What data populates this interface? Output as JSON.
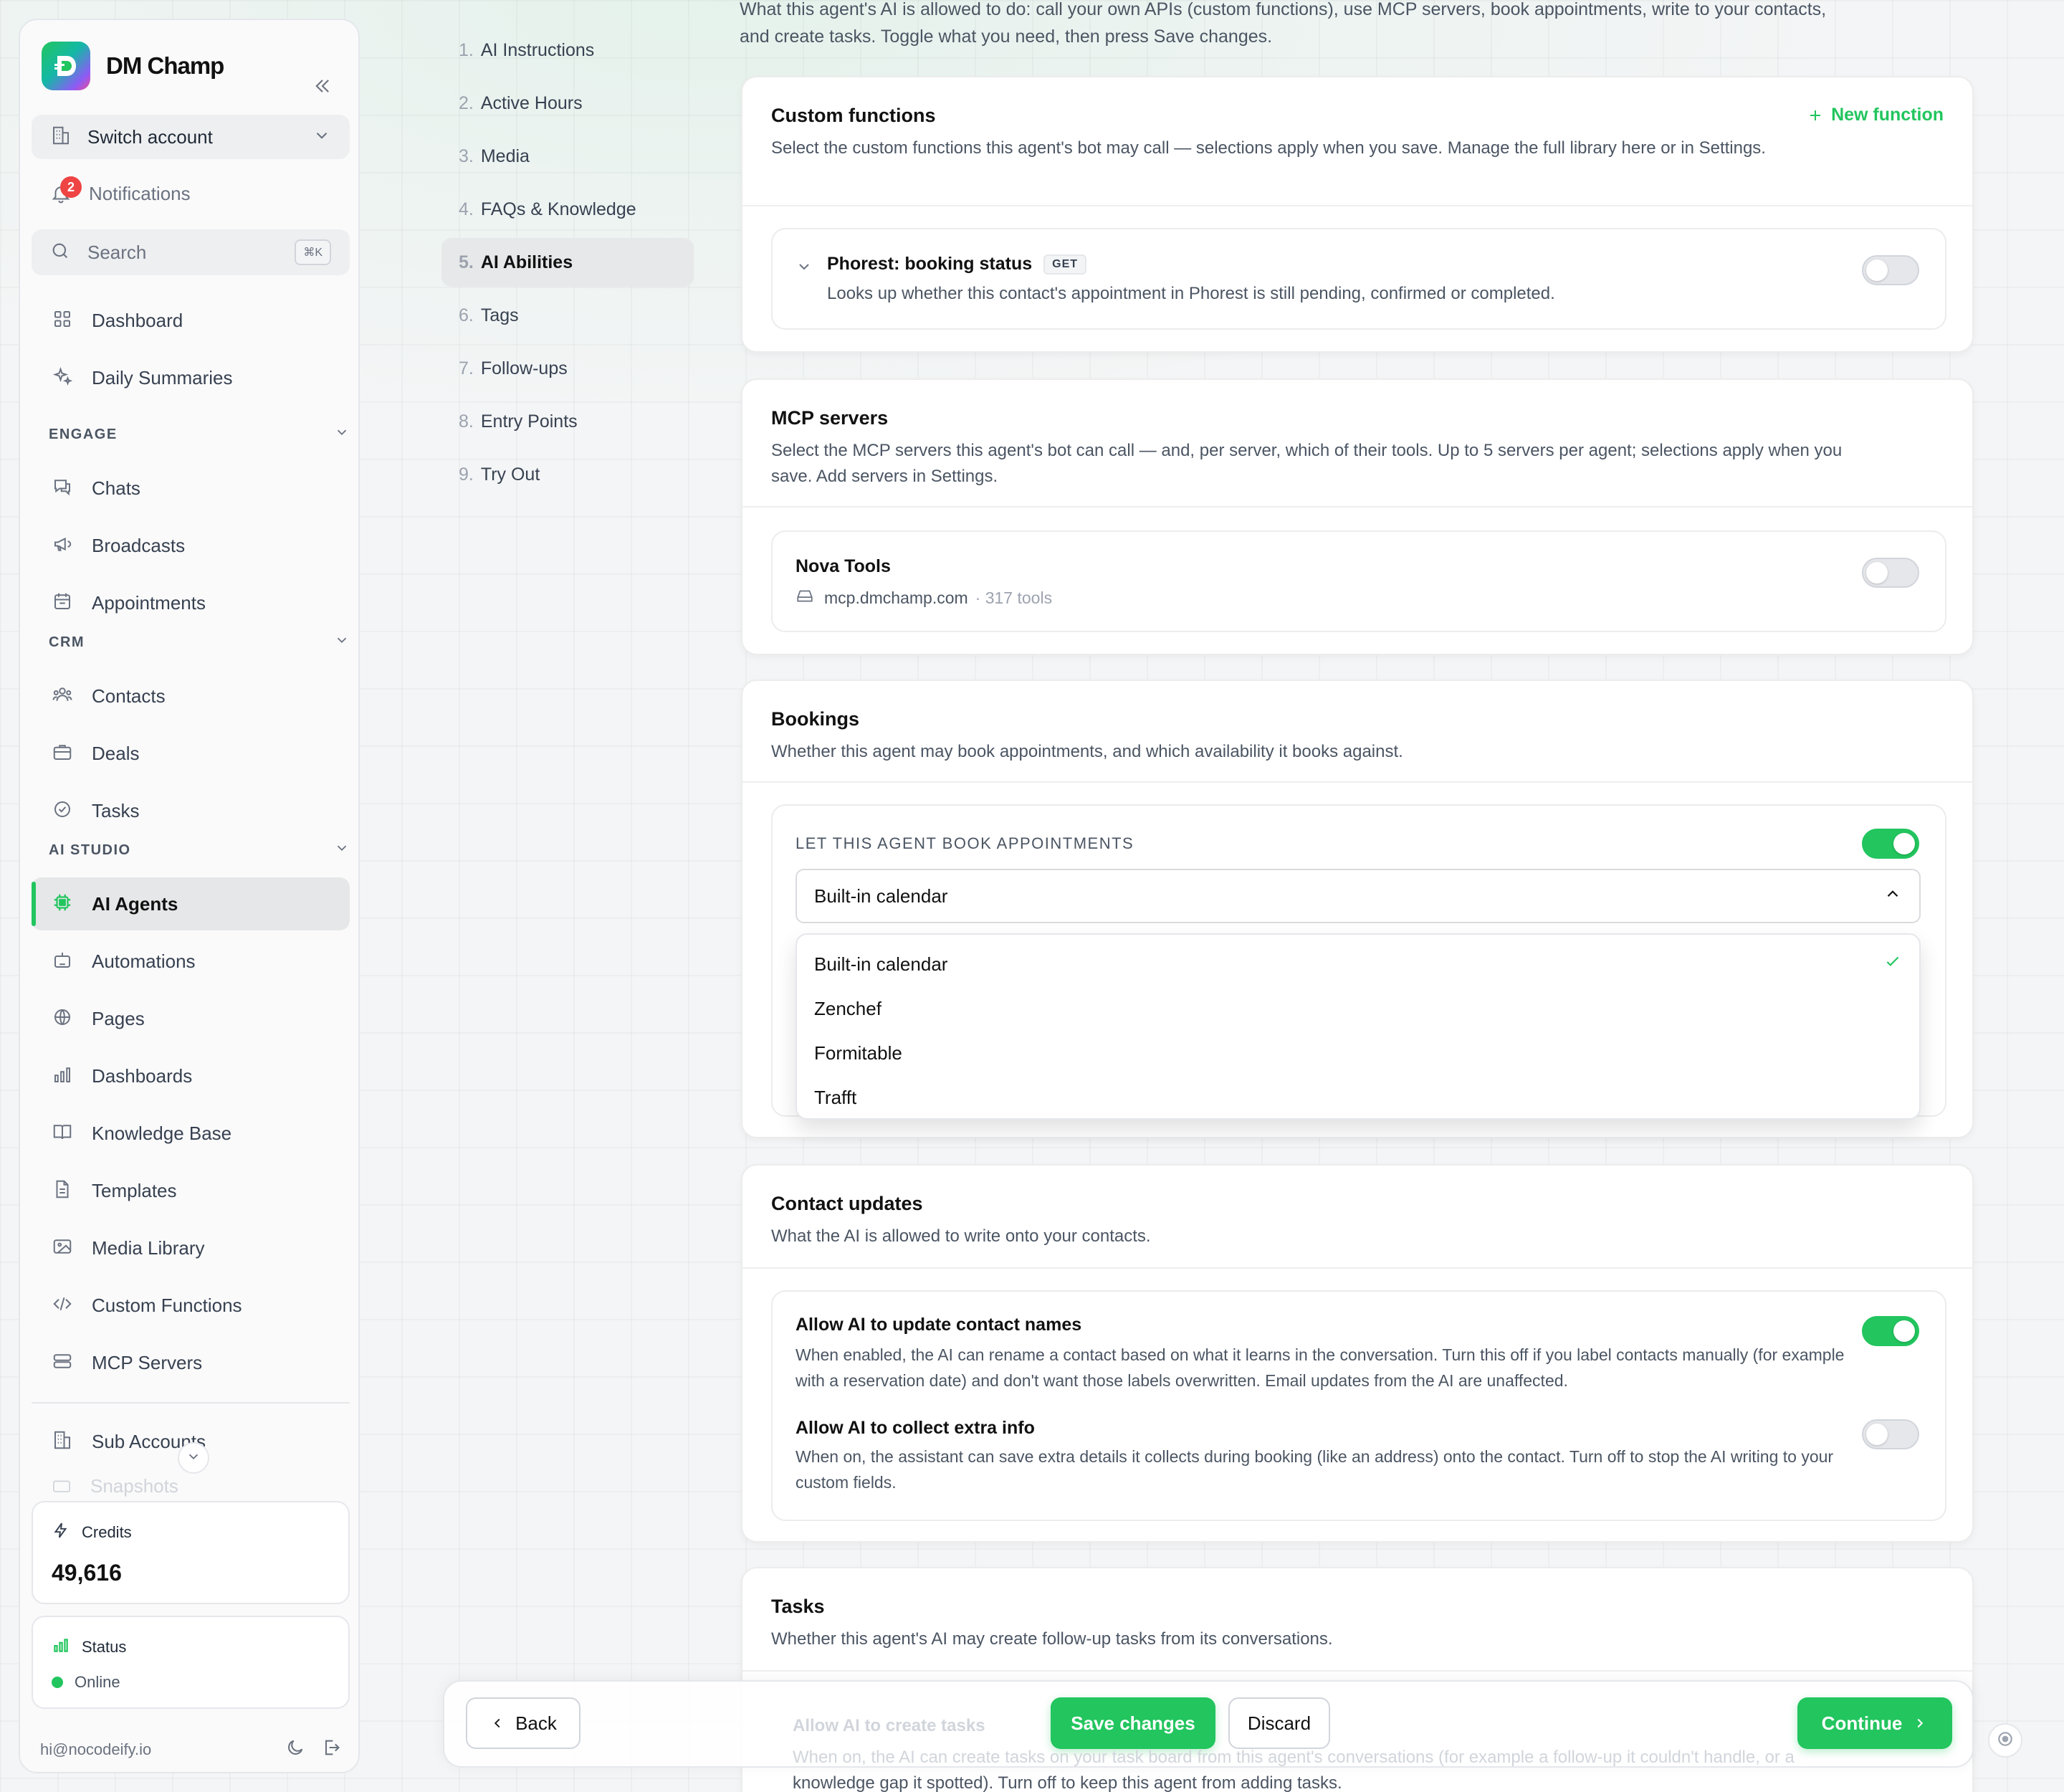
{
  "brand": {
    "name": "DM Champ"
  },
  "sidebar": {
    "switch_account": "Switch account",
    "notifications": {
      "label": "Notifications",
      "count": "2"
    },
    "search": {
      "label": "Search",
      "shortcut": "⌘K"
    },
    "top_items": [
      {
        "label": "Dashboard",
        "icon": "grid-icon"
      },
      {
        "label": "Daily Summaries",
        "icon": "sparkles-icon"
      }
    ],
    "sections": [
      {
        "title": "ENGAGE",
        "items": [
          {
            "label": "Chats",
            "icon": "chat-icon"
          },
          {
            "label": "Broadcasts",
            "icon": "megaphone-icon"
          },
          {
            "label": "Appointments",
            "icon": "calendar-icon"
          }
        ]
      },
      {
        "title": "CRM",
        "items": [
          {
            "label": "Contacts",
            "icon": "users-icon"
          },
          {
            "label": "Deals",
            "icon": "briefcase-icon"
          },
          {
            "label": "Tasks",
            "icon": "check-circle-icon"
          }
        ]
      },
      {
        "title": "AI STUDIO",
        "items": [
          {
            "label": "AI Agents",
            "icon": "chip-icon",
            "active": true
          },
          {
            "label": "Automations",
            "icon": "robot-icon"
          },
          {
            "label": "Pages",
            "icon": "globe-icon"
          },
          {
            "label": "Dashboards",
            "icon": "bar-chart-icon"
          },
          {
            "label": "Knowledge Base",
            "icon": "book-icon"
          },
          {
            "label": "Templates",
            "icon": "document-icon"
          },
          {
            "label": "Media Library",
            "icon": "image-icon"
          },
          {
            "label": "Custom Functions",
            "icon": "code-icon"
          },
          {
            "label": "MCP Servers",
            "icon": "server-icon"
          }
        ]
      }
    ],
    "sub_accounts": "Sub Accounts",
    "faded_item": "Snapshots",
    "credits": {
      "label": "Credits",
      "value": "49,616"
    },
    "status": {
      "label": "Status",
      "value": "Online"
    },
    "user_email": "hi@nocodeify.io"
  },
  "steps": [
    {
      "num": "1.",
      "label": "AI Instructions"
    },
    {
      "num": "2.",
      "label": "Active Hours"
    },
    {
      "num": "3.",
      "label": "Media"
    },
    {
      "num": "4.",
      "label": "FAQs & Knowledge"
    },
    {
      "num": "5.",
      "label": "AI Abilities",
      "active": true
    },
    {
      "num": "6.",
      "label": "Tags"
    },
    {
      "num": "7.",
      "label": "Follow-ups"
    },
    {
      "num": "8.",
      "label": "Entry Points"
    },
    {
      "num": "9.",
      "label": "Try Out"
    }
  ],
  "intro": "What this agent's AI is allowed to do: call your own APIs (custom functions), use MCP servers, book appointments, write to your contacts, and create tasks. Toggle what you need, then press Save changes.",
  "custom_functions": {
    "title": "Custom functions",
    "description": "Select the custom functions this agent's bot may call — selections apply when you save. Manage the full library here or in Settings.",
    "new_button": "New function",
    "items": [
      {
        "name": "Phorest: booking status",
        "method": "GET",
        "description": "Looks up whether this contact's appointment in Phorest is still pending, confirmed or completed.",
        "enabled": false
      }
    ]
  },
  "mcp": {
    "title": "MCP servers",
    "description": "Select the MCP servers this agent's bot can call — and, per server, which of their tools. Up to 5 servers per agent; selections apply when you save. Add servers in Settings.",
    "servers": [
      {
        "name": "Nova Tools",
        "host": "mcp.dmchamp.com",
        "tools": "· 317 tools",
        "enabled": false
      }
    ]
  },
  "bookings": {
    "title": "Bookings",
    "description": "Whether this agent may book appointments, and which availability it books against.",
    "toggle_label": "LET THIS AGENT BOOK APPOINTMENTS",
    "enabled": true,
    "selected": "Built-in calendar",
    "options": [
      "Built-in calendar",
      "Zenchef",
      "Formitable",
      "Trafft"
    ]
  },
  "contact_updates": {
    "title": "Contact updates",
    "description": "What the AI is allowed to write onto your contacts.",
    "items": [
      {
        "title": "Allow AI to update contact names",
        "description": "When enabled, the AI can rename a contact based on what it learns in the conversation. Turn this off if you label contacts manually (for example with a reservation date) and don't want those labels overwritten. Email updates from the AI are unaffected.",
        "enabled": true
      },
      {
        "title": "Allow AI to collect extra info",
        "description": "When on, the assistant can save extra details it collects during booking (like an address) onto the contact. Turn off to stop the AI writing to your custom fields.",
        "enabled": false
      }
    ]
  },
  "tasks": {
    "title": "Tasks",
    "description": "Whether this agent's AI may create follow-up tasks from its conversations.",
    "item_title": "Allow AI to create tasks",
    "item_desc_1": "When on, the AI can create tasks on your task board from this agent's conversations (for example a follow-up it couldn't handle, or a",
    "item_desc_2": "knowledge gap it spotted). Turn off to keep this agent from adding tasks."
  },
  "bottom_bar": {
    "back": "Back",
    "save": "Save changes",
    "discard": "Discard",
    "continue": "Continue"
  },
  "colors": {
    "accent": "#22c55e",
    "badge": "#ef4444"
  }
}
